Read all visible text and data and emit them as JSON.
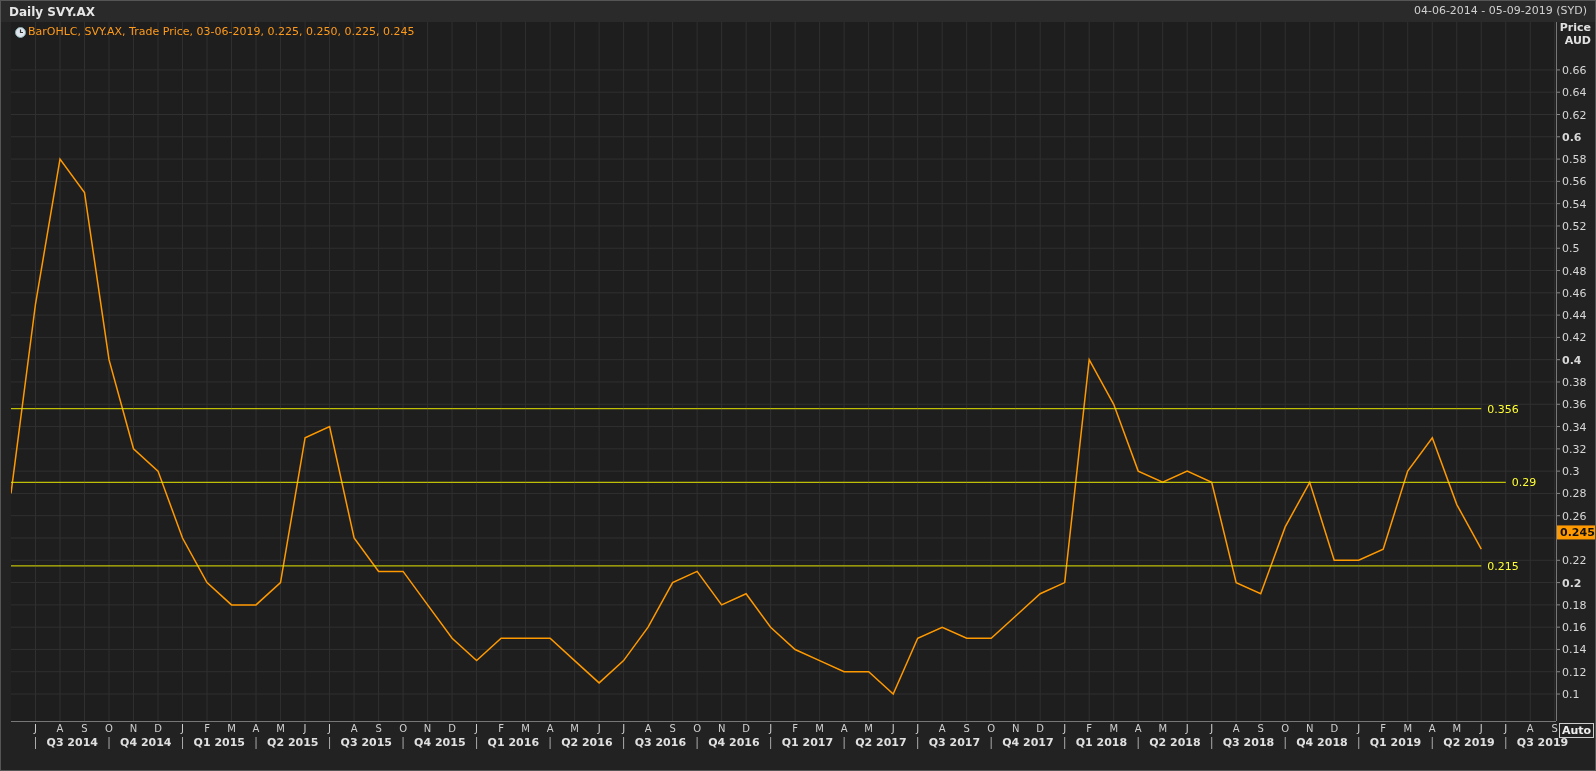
{
  "window": {
    "title": "Daily SVY.AX",
    "date_range": "04-06-2014 - 05-09-2019 (SYD)"
  },
  "legend": {
    "text": "BarOHLC, SVY.AX, Trade Price, 03-06-2019, 0.225, 0.250, 0.225, 0.245"
  },
  "axis": {
    "title": "Price",
    "unit": "AUD",
    "auto_button": "Auto"
  },
  "chart": {
    "chart_data": {
      "type": "line",
      "ylim": [
        0.0758,
        0.703
      ],
      "grid": true,
      "categories": [
        null,
        "J",
        "A",
        "S",
        "O",
        "N",
        "D",
        "J",
        "F",
        "M",
        "A",
        "M",
        "J",
        "J",
        "A",
        "S",
        "O",
        "N",
        "D",
        "J",
        "F",
        "M",
        "A",
        "M",
        "J",
        "J",
        "A",
        "S",
        "O",
        "N",
        "D",
        "J",
        "F",
        "M",
        "A",
        "M",
        "J",
        "J",
        "A",
        "S",
        "O",
        "N",
        "D",
        "J",
        "F",
        "M",
        "A",
        "M",
        "J",
        "J",
        "A",
        "S",
        "O",
        "N",
        "D",
        "J",
        "F",
        "M",
        "A",
        "M",
        "J",
        "J",
        "A",
        "S"
      ],
      "series": [
        {
          "color": "#ff9900",
          "values": [
            0.28,
            0.45,
            0.58,
            0.55,
            0.4,
            0.32,
            0.3,
            0.24,
            0.2,
            0.18,
            0.18,
            0.2,
            0.33,
            0.34,
            0.24,
            0.21,
            0.21,
            0.18,
            0.15,
            0.13,
            0.15,
            0.15,
            0.15,
            0.13,
            0.11,
            0.13,
            0.16,
            0.2,
            0.21,
            0.18,
            0.19,
            0.16,
            0.14,
            0.13,
            0.12,
            0.12,
            0.1,
            0.15,
            0.16,
            0.15,
            0.15,
            0.17,
            0.19,
            0.2,
            0.4,
            0.36,
            0.3,
            0.29,
            0.3,
            0.29,
            0.2,
            0.19,
            0.25,
            0.29,
            0.22,
            0.22,
            0.23,
            0.3,
            0.33,
            0.27,
            0.23,
            null,
            null,
            null
          ]
        },
        {
          "name": "0.356",
          "color": "#e6e600",
          "values": [
            0.356,
            0.356,
            0.356,
            0.356,
            0.356,
            0.356,
            0.356,
            0.356,
            0.356,
            0.356,
            0.356,
            0.356,
            0.356,
            0.356,
            0.356,
            0.356,
            0.356,
            0.356,
            0.356,
            0.356,
            0.356,
            0.356,
            0.356,
            0.356,
            0.356,
            0.356,
            0.356,
            0.356,
            0.356,
            0.356,
            0.356,
            0.356,
            0.356,
            0.356,
            0.356,
            0.356,
            0.356,
            0.356,
            0.356,
            0.356,
            0.356,
            0.356,
            0.356,
            0.356,
            0.356,
            0.356,
            0.356,
            0.356,
            0.356,
            0.356,
            0.356,
            0.356,
            0.356,
            0.356,
            0.356,
            0.356,
            0.356,
            0.356,
            0.356,
            0.356,
            0.356,
            null,
            null,
            null
          ]
        },
        {
          "name": "0.29",
          "color": "#e6e600",
          "values": [
            0.29,
            0.29,
            0.29,
            0.29,
            0.29,
            0.29,
            0.29,
            0.29,
            0.29,
            0.29,
            0.29,
            0.29,
            0.29,
            0.29,
            0.29,
            0.29,
            0.29,
            0.29,
            0.29,
            0.29,
            0.29,
            0.29,
            0.29,
            0.29,
            0.29,
            0.29,
            0.29,
            0.29,
            0.29,
            0.29,
            0.29,
            0.29,
            0.29,
            0.29,
            0.29,
            0.29,
            0.29,
            0.29,
            0.29,
            0.29,
            0.29,
            0.29,
            0.29,
            0.29,
            0.29,
            0.29,
            0.29,
            0.29,
            0.29,
            0.29,
            0.29,
            0.29,
            0.29,
            0.29,
            0.29,
            0.29,
            0.29,
            0.29,
            0.29,
            0.29,
            0.29,
            0.29,
            null,
            null
          ]
        },
        {
          "name": "0.215",
          "color": "#e6e600",
          "values": [
            0.215,
            0.215,
            0.215,
            0.215,
            0.215,
            0.215,
            0.215,
            0.215,
            0.215,
            0.215,
            0.215,
            0.215,
            0.215,
            0.215,
            0.215,
            0.215,
            0.215,
            0.215,
            0.215,
            0.215,
            0.215,
            0.215,
            0.215,
            0.215,
            0.215,
            0.215,
            0.215,
            0.215,
            0.215,
            0.215,
            0.215,
            0.215,
            0.215,
            0.215,
            0.215,
            0.215,
            0.215,
            0.215,
            0.215,
            0.215,
            0.215,
            0.215,
            0.215,
            0.215,
            0.215,
            0.215,
            0.215,
            0.215,
            0.215,
            0.215,
            0.215,
            0.215,
            0.215,
            0.215,
            0.215,
            0.215,
            0.215,
            0.215,
            0.215,
            0.215,
            0.215,
            null,
            null,
            null
          ]
        }
      ],
      "yticks": [
        0.1,
        0.12,
        0.14,
        0.16,
        0.18,
        0.2,
        0.22,
        0.26,
        0.28,
        0.3,
        0.32,
        0.34,
        0.36,
        0.38,
        0.4,
        0.42,
        0.44,
        0.46,
        0.48,
        0.5,
        0.52,
        0.54,
        0.56,
        0.58,
        0.6,
        0.62,
        0.64,
        0.66
      ],
      "annotations": [
        {
          "y": 0.245,
          "text": "0.245"
        }
      ]
    },
    "quarters": [
      "Q3 2014",
      "Q4 2014",
      "Q1 2015",
      "Q2 2015",
      "Q3 2015",
      "Q4 2015",
      "Q1 2016",
      "Q2 2016",
      "Q3 2016",
      "Q4 2016",
      "Q1 2017",
      "Q2 2017",
      "Q3 2017",
      "Q4 2017",
      "Q1 2018",
      "Q2 2018",
      "Q3 2018",
      "Q4 2018",
      "Q1 2019",
      "Q2 2019",
      "Q3 2019"
    ]
  }
}
